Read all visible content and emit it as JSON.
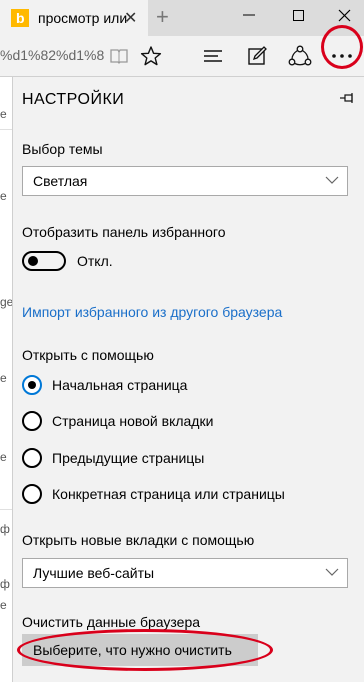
{
  "tab": {
    "title": "просмотр или",
    "favicon_letter": "b",
    "close_glyph": "✕",
    "new_tab_glyph": "+"
  },
  "window": {
    "minimize": "—",
    "maximize": "☐",
    "close": "✕"
  },
  "toolbar": {
    "address_fragment": "%d1%82%d1%8",
    "icons": [
      "reading-view-icon",
      "favorites-star-icon",
      "hub-icon",
      "web-note-icon",
      "share-icon",
      "more-icon"
    ]
  },
  "page_behind": {
    "fragments": [
      "e",
      "e",
      "ge",
      "e",
      "e",
      "ф",
      "ф",
      "e"
    ]
  },
  "settings": {
    "title": "НАСТРОЙКИ",
    "theme_label": "Выбор темы",
    "theme_value": "Светлая",
    "favorites_bar_label": "Отобразить панель избранного",
    "favorites_bar_toggle": "Откл.",
    "import_link": "Импорт избранного из другого браузера",
    "open_with_label": "Открыть с помощью",
    "open_with_options": [
      {
        "label": "Начальная страница",
        "checked": true
      },
      {
        "label": "Страница новой вкладки",
        "checked": false
      },
      {
        "label": "Предыдущие страницы",
        "checked": false
      },
      {
        "label": "Конкретная страница или страницы",
        "checked": false
      }
    ],
    "new_tabs_label": "Открыть новые вкладки с помощью",
    "new_tabs_value": "Лучшие веб-сайты",
    "clear_data_label": "Очистить данные браузера",
    "clear_data_button": "Выберите, что нужно очистить"
  },
  "colors": {
    "accent_link": "#1a6fc9",
    "annotation_red": "#d9001b",
    "radio_selected_border": "#0078d7",
    "bing_yellow": "#ffb900"
  }
}
